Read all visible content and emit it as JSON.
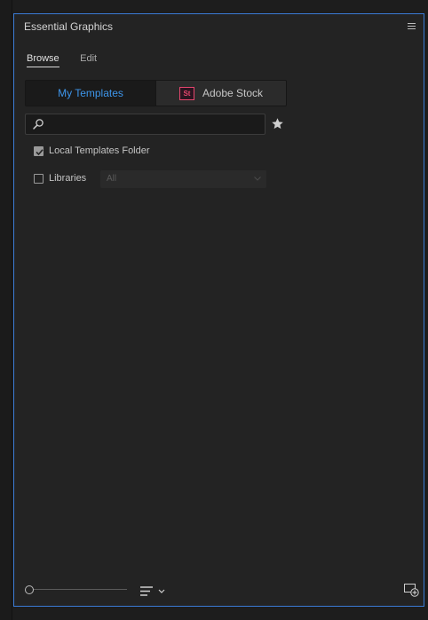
{
  "panel": {
    "title": "Essential Graphics"
  },
  "tabs": [
    {
      "label": "Browse",
      "active": true
    },
    {
      "label": "Edit",
      "active": false
    }
  ],
  "source_toggle": {
    "my_templates": "My Templates",
    "adobe_stock": "Adobe Stock",
    "stock_logo_text": "St",
    "active": "my_templates"
  },
  "search": {
    "value": "",
    "placeholder": ""
  },
  "filters": {
    "local_templates": {
      "label": "Local Templates Folder",
      "checked": true
    },
    "libraries": {
      "label": "Libraries",
      "checked": false,
      "select_value": "All"
    }
  },
  "footer": {
    "zoom_level": 0
  },
  "colors": {
    "accent": "#3d95ea",
    "panel_border": "#3a7bd5",
    "stock_brand": "#e5466d"
  }
}
